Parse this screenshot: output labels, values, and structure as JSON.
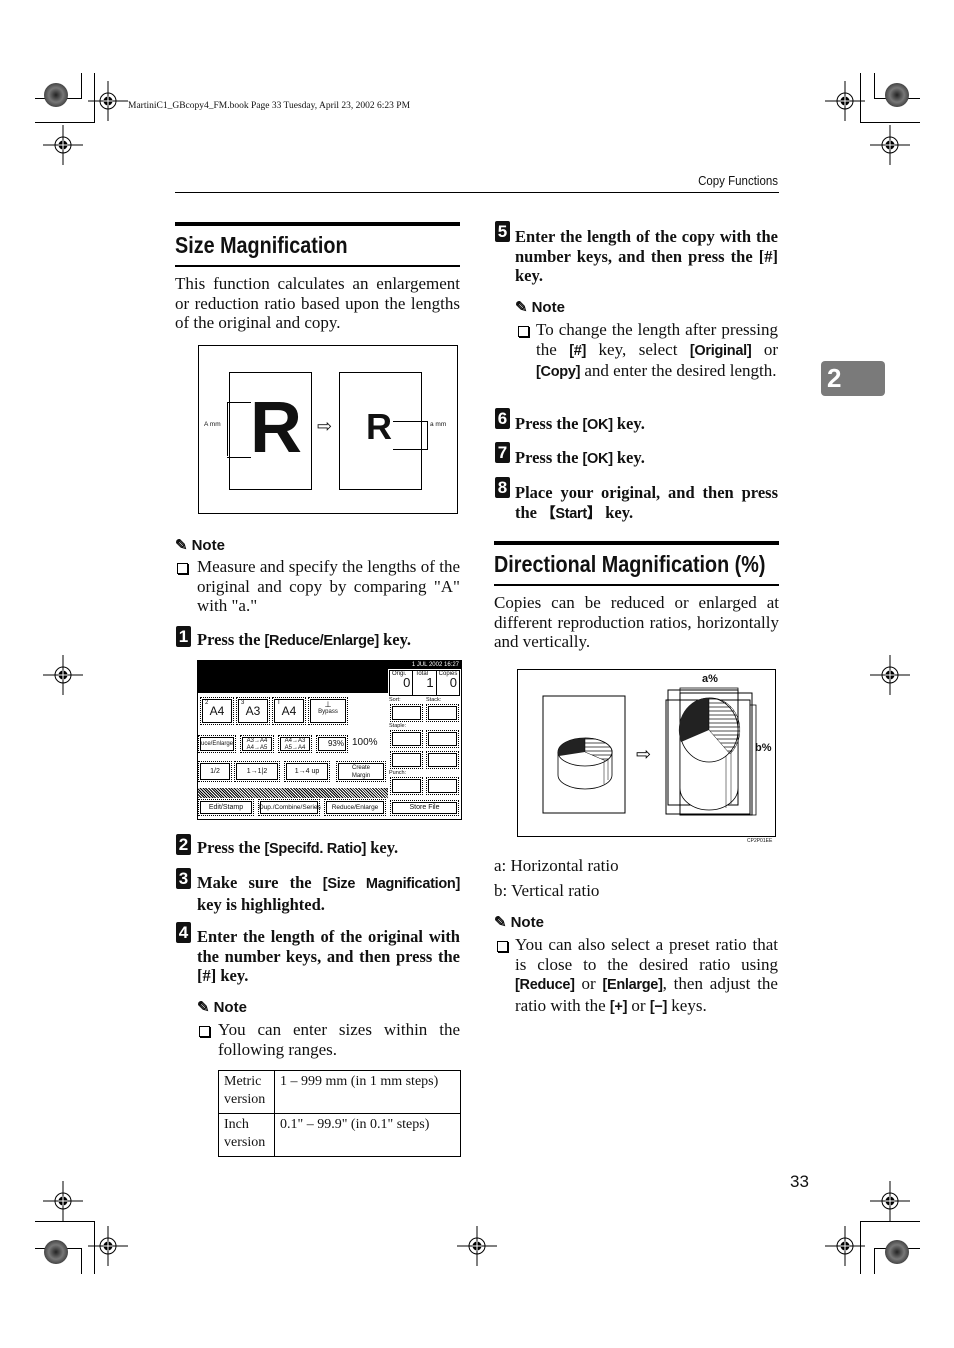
{
  "print_info": "MartiniC1_GBcopy4_FM.book  Page 33  Tuesday, April 23, 2002  6:23 PM",
  "running_head": "Copy Functions",
  "chapter_tab": "2",
  "page_number": "33",
  "left_column": {
    "size_magnification": {
      "title": "Size Magnification",
      "intro": "This function calculates an enlargement or reduction ratio based upon the lengths of the original and copy.",
      "figure": {
        "original_letter": "R",
        "copy_letter": "R",
        "original_label": "A mm",
        "copy_label": "a mm",
        "arrow": "hollow-right-arrow"
      },
      "note_title": "Note",
      "note_items": [
        "Measure and specify the lengths of the original and copy by comparing \"A\" with \"a.\""
      ],
      "steps": [
        {
          "num": "1",
          "pre": "Press the ",
          "key": "[Reduce/Enlarge]",
          "post": " key."
        },
        {
          "num": "2",
          "pre": "Press the ",
          "key": "[Specifd. Ratio]",
          "post": " key."
        },
        {
          "num": "3",
          "pre": "Make sure the ",
          "key": "[Size Magnification]",
          "post": " key is highlighted."
        },
        {
          "num": "4",
          "pre": "Enter the length of the original with the number keys, and then press the [#] key.",
          "key": "",
          "post": ""
        }
      ],
      "step4_note_title": "Note",
      "step4_note_items": [
        "You can enter sizes within the following ranges."
      ],
      "ranges_table": [
        {
          "label": "Metric version",
          "value": "1 – 999 mm (in 1 mm steps)"
        },
        {
          "label": "Inch version",
          "value": "0.1\" – 99.9\" (in 0.1\" steps)"
        }
      ]
    },
    "copier_panel": {
      "clock": "1 JUL  2002 16:27",
      "counters": [
        {
          "label": "Origi.",
          "value": "0"
        },
        {
          "label": "Total",
          "value": "1"
        },
        {
          "label": "Copies",
          "value": "0"
        }
      ],
      "paper_trays": [
        {
          "tray": "2",
          "size": "A4"
        },
        {
          "tray": "3",
          "size": "A3"
        },
        {
          "tray": "T",
          "size": "A4"
        },
        {
          "tray": "",
          "size": "Bypass"
        }
      ],
      "ratio_row": [
        "uce/Enlarge",
        "A3→A4 A4→A5",
        "A4→A3 A5→A4",
        "93%"
      ],
      "ratio_display": "100%",
      "layout_row": [
        "1/2",
        "1→1|2",
        "1→4 up",
        "Create Margin"
      ],
      "finisher": {
        "sort_label": "Sort:",
        "stack_label": "Stack:",
        "staple_label": "Staple:",
        "punch_label": "Punch:",
        "store_file": "Store File"
      },
      "tabs": [
        "Edit/Stamp",
        "Dup./Combine/Series",
        "Reduce/Enlarge"
      ]
    }
  },
  "right_column": {
    "steps_top": [
      {
        "num": "5",
        "text": "Enter the length of the copy with the number keys, and then press the [#] key."
      }
    ],
    "step5_note_title": "Note",
    "step5_note": {
      "p1": "To change the length after pressing the ",
      "k1": "[#]",
      "p2": " key, select ",
      "k2": "[Original]",
      "p3": " or ",
      "k3": "[Copy]",
      "p4": " and enter the desired length."
    },
    "steps_bottom": [
      {
        "num": "6",
        "pre": "Press the ",
        "key": "[OK]",
        "post": " key."
      },
      {
        "num": "7",
        "pre": "Press the ",
        "key": "[OK]",
        "post": " key."
      },
      {
        "num": "8",
        "pre": "Place your original, and then press the ",
        "key": "【Start】",
        "post": " key."
      }
    ],
    "directional": {
      "title": "Directional Magnification (%)",
      "intro": "Copies can be reduced or enlarged at different reproduction ratios, horizontally and vertically.",
      "figure": {
        "label_a": "a%",
        "label_b": "b%",
        "code": "CP2P01EE"
      },
      "legend": [
        "a: Horizontal ratio",
        "b: Vertical ratio"
      ],
      "note_title": "Note",
      "note": {
        "p1": "You can also select a preset ratio that is close to the desired ratio using ",
        "k1": "[Reduce]",
        "p2": " or ",
        "k2": "[Enlarge]",
        "p3": ", then adjust the ratio with the ",
        "k3": "[+]",
        "p4": " or ",
        "k4": "[−]",
        "p5": " keys."
      }
    }
  }
}
